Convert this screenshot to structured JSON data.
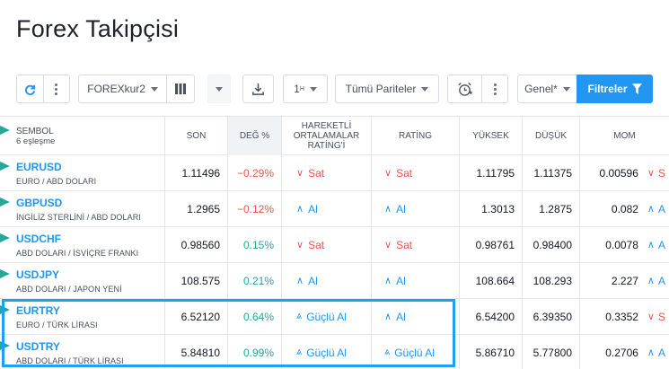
{
  "page": {
    "title": "Forex Takipçisi"
  },
  "toolbar": {
    "list_name": "FOREXkur2",
    "interval": "1",
    "interval_sup": "H",
    "pair_filter": "Tümü Pariteler",
    "preset": "Genel*",
    "filters_label": "Filtreler"
  },
  "columns": {
    "symbol": "SEMBOL",
    "match_count": "6 eşleşme",
    "last": "SON",
    "change": "DEĞ %",
    "ma_rating_1": "HAREKETLİ",
    "ma_rating_2": "ORTALAMALAR",
    "ma_rating_3": "RATİNG'İ",
    "rating": "RATİNG",
    "high": "YÜKSEK",
    "low": "DÜŞÜK",
    "mom": "MOM"
  },
  "rows": [
    {
      "symbol": "EURUSD",
      "desc": "EURO / ABD DOLARI",
      "last": "1.11496",
      "change": "−0.29%",
      "change_dir": "neg",
      "ma": "Sat",
      "ma_dir": "sell",
      "ma_icon": "chevron-down-icon",
      "rating": "Sat",
      "rating_dir": "sell",
      "rating_icon": "chevron-down-icon",
      "high": "1.11795",
      "low": "1.11375",
      "mom": "0.00596",
      "mom_sig": "S",
      "mom_dir": "sell",
      "mom_icon": "chevron-down-icon"
    },
    {
      "symbol": "GBPUSD",
      "desc": "İNGİLİZ STERLİNİ / ABD DOLARI",
      "last": "1.2965",
      "change": "−0.12%",
      "change_dir": "neg",
      "ma": "Al",
      "ma_dir": "buy",
      "ma_icon": "chevron-up-icon",
      "rating": "Al",
      "rating_dir": "buy",
      "rating_icon": "chevron-up-icon",
      "high": "1.3013",
      "low": "1.2875",
      "mom": "0.082",
      "mom_sig": "A",
      "mom_dir": "buy",
      "mom_icon": "chevron-up-icon"
    },
    {
      "symbol": "USDCHF",
      "desc": "ABD DOLARI / İSVİÇRE FRANKI",
      "last": "0.98560",
      "change": "0.15%",
      "change_dir": "pos",
      "ma": "Sat",
      "ma_dir": "sell",
      "ma_icon": "chevron-down-icon",
      "rating": "Sat",
      "rating_dir": "sell",
      "rating_icon": "chevron-down-icon",
      "high": "0.98761",
      "low": "0.98400",
      "mom": "0.0078",
      "mom_sig": "A",
      "mom_dir": "buy",
      "mom_icon": "chevron-up-icon"
    },
    {
      "symbol": "USDJPY",
      "desc": "ABD DOLARI / JAPON YENİ",
      "last": "108.575",
      "change": "0.21%",
      "change_dir": "pos",
      "ma": "Al",
      "ma_dir": "buy",
      "ma_icon": "chevron-up-icon",
      "rating": "Al",
      "rating_dir": "buy",
      "rating_icon": "chevron-up-icon",
      "high": "108.664",
      "low": "108.293",
      "mom": "2.227",
      "mom_sig": "A",
      "mom_dir": "buy",
      "mom_icon": "chevron-up-icon"
    },
    {
      "symbol": "EURTRY",
      "desc": "EURO / TÜRK LİRASI",
      "last": "6.52120",
      "change": "0.64%",
      "change_dir": "pos",
      "ma": "Güçlü Al",
      "ma_dir": "buy",
      "ma_icon": "double-chevron-up-icon",
      "rating": "Al",
      "rating_dir": "buy",
      "rating_icon": "chevron-up-icon",
      "high": "6.54200",
      "low": "6.39350",
      "mom": "0.3352",
      "mom_sig": "S",
      "mom_dir": "sell",
      "mom_icon": "chevron-down-icon"
    },
    {
      "symbol": "USDTRY",
      "desc": "ABD DOLARI / TÜRK LİRASI",
      "last": "5.84810",
      "change": "0.99%",
      "change_dir": "pos",
      "ma": "Güçlü Al",
      "ma_dir": "buy",
      "ma_icon": "double-chevron-up-icon",
      "rating": "Güçlü Al",
      "rating_dir": "buy",
      "rating_icon": "double-chevron-up-icon",
      "high": "5.86710",
      "low": "5.77800",
      "mom": "0.2706",
      "mom_sig": "A",
      "mom_dir": "buy",
      "mom_icon": "chevron-up-icon"
    }
  ],
  "colors": {
    "accent": "#2196f3",
    "buy": "#2196f3",
    "sell": "#ef5350",
    "positive": "#26a69a",
    "negative": "#ef5350",
    "highlight": "#1da1f2"
  }
}
